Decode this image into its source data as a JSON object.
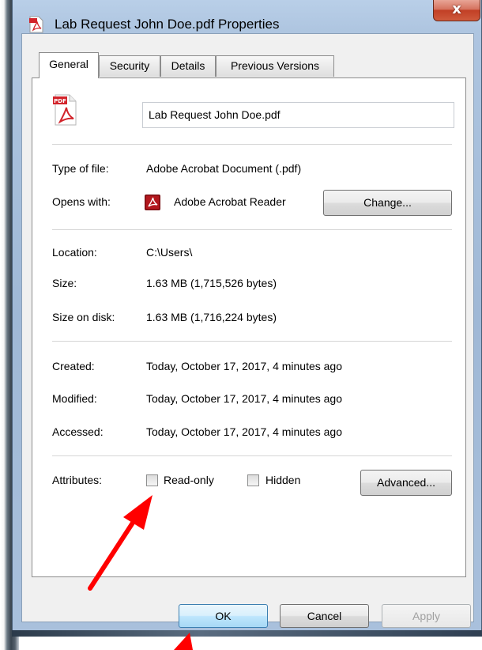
{
  "window": {
    "title": "Lab Request John Doe.pdf Properties",
    "close_glyph": "x"
  },
  "tabs": [
    {
      "label": "General",
      "active": true
    },
    {
      "label": "Security",
      "active": false
    },
    {
      "label": "Details",
      "active": false
    },
    {
      "label": "Previous Versions",
      "active": false
    }
  ],
  "general": {
    "file_icon": "pdf-file-icon",
    "file_icon_text": "PDF",
    "file_name": "Lab Request John Doe.pdf",
    "type_label": "Type of file:",
    "type_value": "Adobe Acrobat Document (.pdf)",
    "opens_label": "Opens with:",
    "opens_value": "Adobe Acrobat Reader",
    "change_button": "Change...",
    "location_label": "Location:",
    "location_value": "C:\\Users\\",
    "size_label": "Size:",
    "size_value": "1.63 MB (1,715,526 bytes)",
    "size_disk_label": "Size on disk:",
    "size_disk_value": "1.63 MB (1,716,224 bytes)",
    "created_label": "Created:",
    "created_value": "Today, October 17, 2017, 4 minutes ago",
    "modified_label": "Modified:",
    "modified_value": "Today, October 17, 2017, 4 minutes ago",
    "accessed_label": "Accessed:",
    "accessed_value": "Today, October 17, 2017, 4 minutes ago",
    "attributes_label": "Attributes:",
    "readonly_label": "Read-only",
    "readonly_checked": false,
    "hidden_label": "Hidden",
    "hidden_checked": false,
    "advanced_button": "Advanced..."
  },
  "footer": {
    "ok_button": "OK",
    "cancel_button": "Cancel",
    "apply_button": "Apply"
  },
  "colors": {
    "acrobat_red": "#d2232a",
    "annotation_arrow": "#ff0000",
    "default_button_border": "#3c7fb1"
  },
  "annotations": [
    {
      "type": "arrow",
      "points_to": "read-only-checkbox",
      "color": "#ff0000"
    },
    {
      "type": "arrow",
      "points_to": "ok-button",
      "color": "#ff0000"
    }
  ]
}
